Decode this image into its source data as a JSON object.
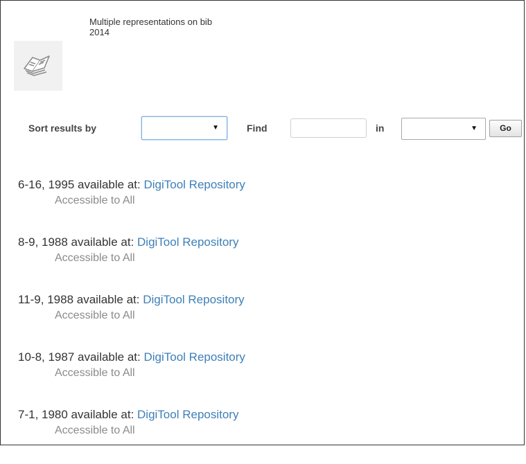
{
  "record": {
    "title_line1": "Multiple representations on bib",
    "title_line2": "2014",
    "thumbnail_icon": "open-book-icon"
  },
  "search": {
    "sort_label": "Sort results by",
    "sort_value": "",
    "find_label": "Find",
    "find_value": "",
    "in_label": "in",
    "in_value": "",
    "go_label": "Go",
    "dropdown_arrow": "▼"
  },
  "results": [
    {
      "prefix": "6-16, 1995 available at: ",
      "link": "DigiTool Repository",
      "access": "Accessible to All"
    },
    {
      "prefix": "8-9, 1988 available at: ",
      "link": "DigiTool Repository",
      "access": "Accessible to All"
    },
    {
      "prefix": "11-9, 1988 available at: ",
      "link": "DigiTool Repository",
      "access": "Accessible to All"
    },
    {
      "prefix": "10-8, 1987 available at: ",
      "link": "DigiTool Repository",
      "access": "Accessible to All"
    },
    {
      "prefix": "7-1, 1980 available at: ",
      "link": "DigiTool Repository",
      "access": "Accessible to All"
    }
  ],
  "colors": {
    "link": "#3d7fb8",
    "muted_text": "#8a8a8a",
    "focus_border": "#7fb4e0"
  }
}
